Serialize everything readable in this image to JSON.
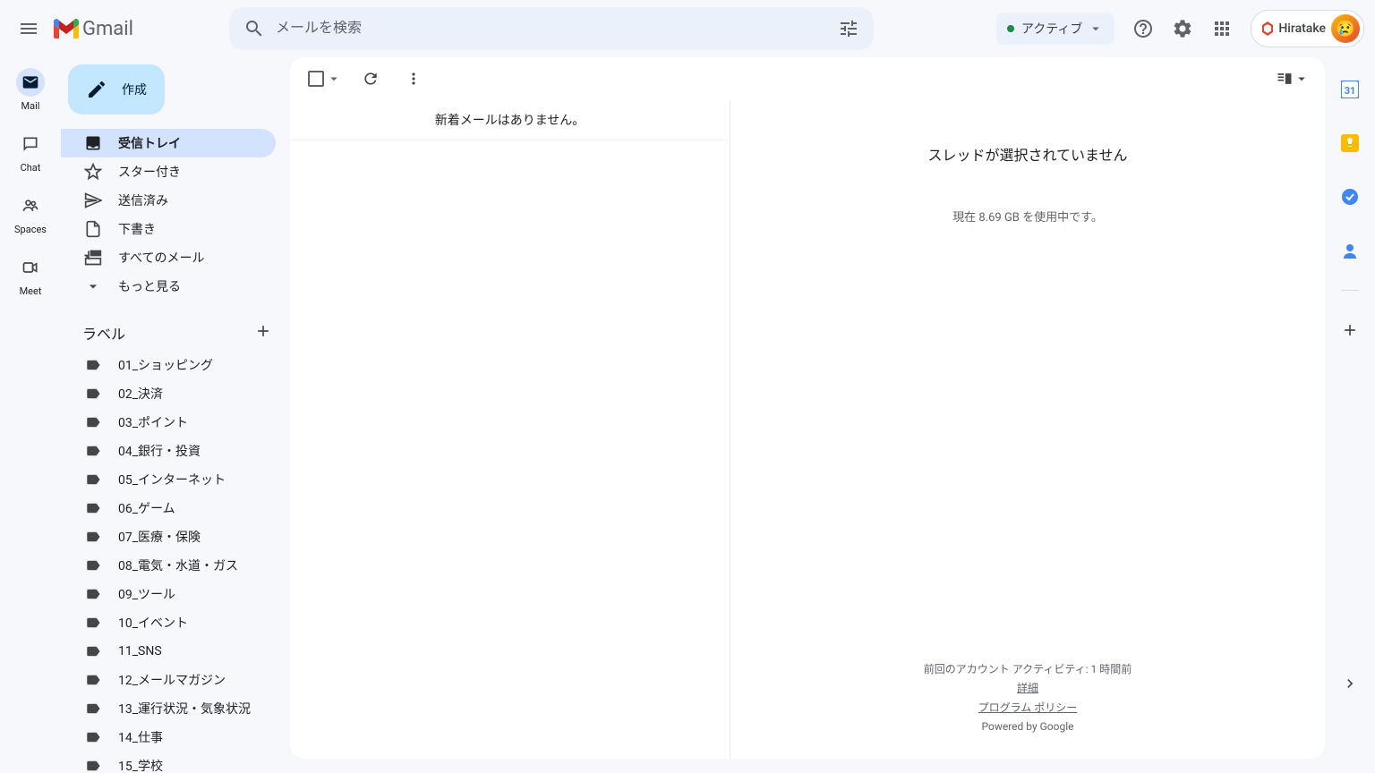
{
  "header": {
    "app_name": "Gmail",
    "search_placeholder": "メールを検索",
    "status_label": "アクティブ",
    "profile_name": "Hiratake"
  },
  "rail": {
    "items": [
      {
        "label": "Mail"
      },
      {
        "label": "Chat"
      },
      {
        "label": "Spaces"
      },
      {
        "label": "Meet"
      }
    ]
  },
  "sidebar": {
    "compose_label": "作成",
    "nav": [
      {
        "label": "受信トレイ"
      },
      {
        "label": "スター付き"
      },
      {
        "label": "送信済み"
      },
      {
        "label": "下書き"
      },
      {
        "label": "すべてのメール"
      },
      {
        "label": "もっと見る"
      }
    ],
    "labels_title": "ラベル",
    "labels": [
      {
        "name": "01_ショッピング"
      },
      {
        "name": "02_決済"
      },
      {
        "name": "03_ポイント"
      },
      {
        "name": "04_銀行・投資"
      },
      {
        "name": "05_インターネット"
      },
      {
        "name": "06_ゲーム"
      },
      {
        "name": "07_医療・保険"
      },
      {
        "name": "08_電気・水道・ガス"
      },
      {
        "name": "09_ツール"
      },
      {
        "name": "10_イベント"
      },
      {
        "name": "11_SNS"
      },
      {
        "name": "12_メールマガジン"
      },
      {
        "name": "13_運行状況・気象状況"
      },
      {
        "name": "14_仕事"
      },
      {
        "name": "15_学校"
      }
    ]
  },
  "main": {
    "empty_list": "新着メールはありません。",
    "no_thread": "スレッドが選択されていません",
    "storage": "現在 8.69 GB を使用中です。",
    "activity": "前回のアカウント アクティビティ: 1 時間前",
    "details": "詳細",
    "policy": "プログラム ポリシー",
    "powered": "Powered by Google"
  }
}
